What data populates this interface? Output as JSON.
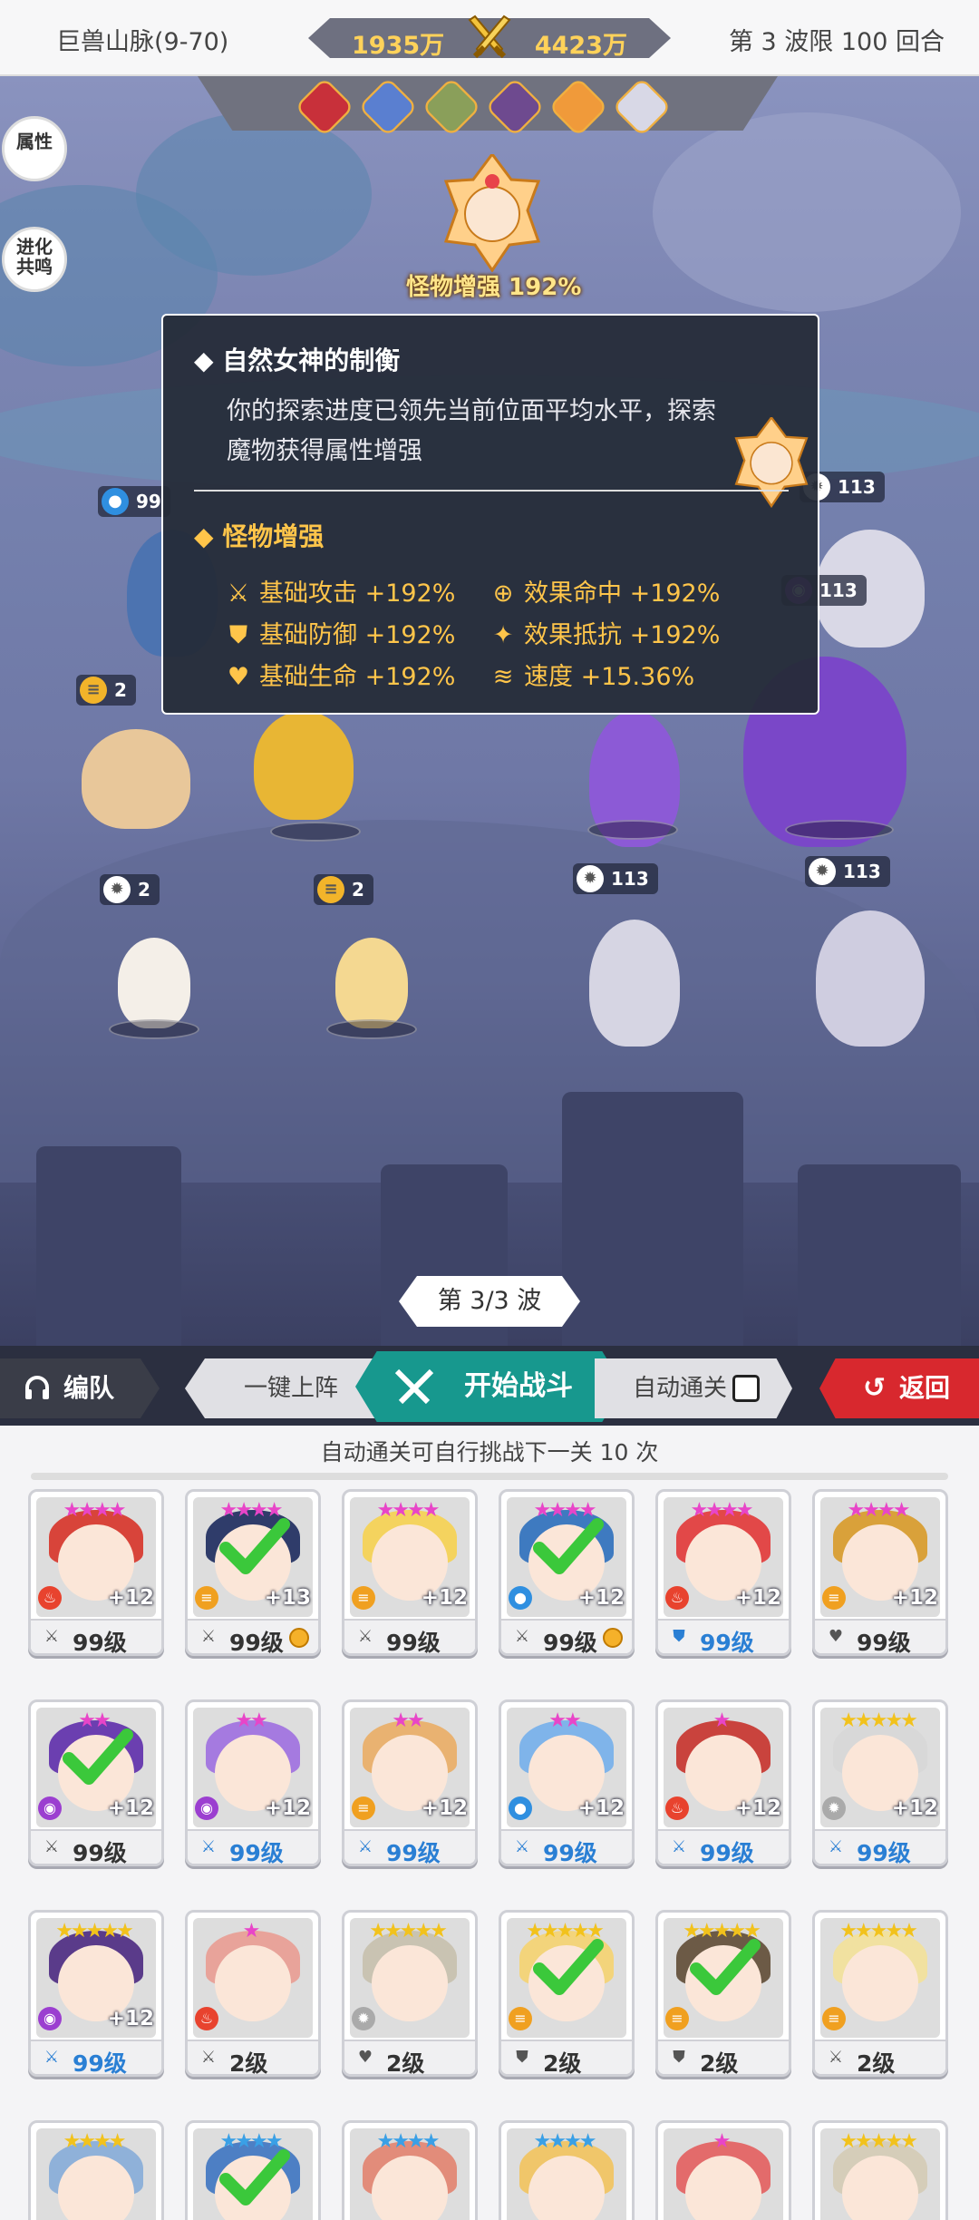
{
  "header": {
    "stage": "巨兽山脉(9-70)",
    "power_left": "1935万",
    "power_right": "4423万",
    "wave_limit": "第 3 波限 100 回合"
  },
  "side_buttons": {
    "attributes": "属性",
    "evolution": "进化\n共鸣"
  },
  "boss": {
    "label": "怪物增强 192%"
  },
  "units": {
    "ally_top_badge": "99",
    "ally_top_badge2": "99",
    "ally_left_badge": "2",
    "ally_front_badge1": "2",
    "ally_front_badge2": "2",
    "enemy_top_badge1": "113",
    "enemy_top_badge2": "113",
    "enemy_mid_badge": "113",
    "enemy_front_badge1": "113",
    "enemy_front_badge2": "113"
  },
  "tooltip": {
    "title": "◆ 自然女神的制衡",
    "desc": "你的探索进度已领先当前位面平均水平，探索魔物获得属性增强",
    "subtitle": "◆ 怪物增强",
    "stats": [
      {
        "icon": "attack-icon",
        "label": "基础攻击 +192%"
      },
      {
        "icon": "defense-icon",
        "label": "基础防御 +192%"
      },
      {
        "icon": "health-icon",
        "label": "基础生命 +192%"
      },
      {
        "icon": "accuracy-icon",
        "label": "效果命中 +192%"
      },
      {
        "icon": "resist-icon",
        "label": "效果抵抗 +192%"
      },
      {
        "icon": "speed-icon",
        "label": "速度 +15.36%"
      }
    ]
  },
  "wave": {
    "label": "第 3/3 波"
  },
  "actions": {
    "team": "编队",
    "deploy": "一键上阵",
    "start": "开始战斗",
    "auto": "自动通关",
    "back": "返回"
  },
  "roster": {
    "note": "自动通关可自行挑战下一关 10 次",
    "cards": [
      {
        "stars": "★★★★",
        "star_color": "#e845c8",
        "plus": "+12",
        "level": "99级",
        "elem": "fire",
        "elem_color": "#e8432e",
        "hair": "#d8443a",
        "lv_icon": "attack-icon",
        "blue": false,
        "check": false,
        "badge": false
      },
      {
        "stars": "★★★★",
        "star_color": "#e845c8",
        "plus": "+13",
        "level": "99级",
        "elem": "earth",
        "elem_color": "#f0a020",
        "hair": "#2f3c6a",
        "lv_icon": "attack-icon",
        "blue": false,
        "check": true,
        "badge": true
      },
      {
        "stars": "★★★★",
        "star_color": "#e845c8",
        "plus": "+12",
        "level": "99级",
        "elem": "earth",
        "elem_color": "#f0a020",
        "hair": "#f4d35e",
        "lv_icon": "attack-icon",
        "blue": false,
        "check": false,
        "badge": false
      },
      {
        "stars": "★★★★",
        "star_color": "#e845c8",
        "plus": "+12",
        "level": "99级",
        "elem": "water",
        "elem_color": "#2f8fe0",
        "hair": "#3e7ac0",
        "lv_icon": "attack-icon",
        "blue": false,
        "check": true,
        "badge": true
      },
      {
        "stars": "★★★★",
        "star_color": "#e845c8",
        "plus": "+12",
        "level": "99级",
        "elem": "fire",
        "elem_color": "#e8432e",
        "hair": "#e24848",
        "lv_icon": "defense-icon",
        "blue": true,
        "check": false,
        "badge": false
      },
      {
        "stars": "★★★★",
        "star_color": "#e845c8",
        "plus": "+12",
        "level": "99级",
        "elem": "earth",
        "elem_color": "#f0a020",
        "hair": "#d9a13a",
        "lv_icon": "health-icon",
        "blue": false,
        "check": false,
        "badge": false
      },
      {
        "stars": "★★",
        "star_color": "#e845c8",
        "plus": "+12",
        "level": "99级",
        "elem": "dark",
        "elem_color": "#9b3fd0",
        "hair": "#6b3fb0",
        "lv_icon": "attack-icon",
        "blue": false,
        "check": true,
        "badge": false
      },
      {
        "stars": "★★",
        "star_color": "#e845c8",
        "plus": "+12",
        "level": "99级",
        "elem": "dark",
        "elem_color": "#9b3fd0",
        "hair": "#a57ae0",
        "lv_icon": "attack-icon",
        "blue": true,
        "check": false,
        "badge": false
      },
      {
        "stars": "★★",
        "star_color": "#e845c8",
        "plus": "+12",
        "level": "99级",
        "elem": "earth",
        "elem_color": "#f0a020",
        "hair": "#e9b271",
        "lv_icon": "attack-icon",
        "blue": true,
        "check": false,
        "badge": false
      },
      {
        "stars": "★★",
        "star_color": "#e845c8",
        "plus": "+12",
        "level": "99级",
        "elem": "water",
        "elem_color": "#2f8fe0",
        "hair": "#7fb4ea",
        "lv_icon": "attack-icon",
        "blue": true,
        "check": false,
        "badge": false
      },
      {
        "stars": "★",
        "star_color": "#e845c8",
        "plus": "+12",
        "level": "99级",
        "elem": "fire",
        "elem_color": "#e8432e",
        "hair": "#c9433d",
        "lv_icon": "attack-icon",
        "blue": true,
        "check": false,
        "badge": false
      },
      {
        "stars": "★★★★★",
        "star_color": "#f2c21c",
        "plus": "+12",
        "level": "99级",
        "elem": "light",
        "elem_color": "#aaaaaa",
        "hair": "#d8d8d8",
        "lv_icon": "attack-icon",
        "blue": true,
        "check": false,
        "badge": false
      },
      {
        "stars": "★★★★★",
        "star_color": "#f2c21c",
        "plus": "+12",
        "level": "99级",
        "elem": "dark",
        "elem_color": "#9b3fd0",
        "hair": "#5a3b8a",
        "lv_icon": "attack-icon",
        "blue": true,
        "check": false,
        "badge": false
      },
      {
        "stars": "★",
        "star_color": "#e845c8",
        "plus": "",
        "level": "2级",
        "elem": "fire",
        "elem_color": "#e8432e",
        "hair": "#e8a39a",
        "lv_icon": "attack-icon",
        "blue": false,
        "check": false,
        "badge": false
      },
      {
        "stars": "★★★★★",
        "star_color": "#f2c21c",
        "plus": "",
        "level": "2级",
        "elem": "light",
        "elem_color": "#aaaaaa",
        "hair": "#c9c3b2",
        "lv_icon": "health-icon",
        "blue": false,
        "check": false,
        "badge": false
      },
      {
        "stars": "★★★★★",
        "star_color": "#f2c21c",
        "plus": "",
        "level": "2级",
        "elem": "earth",
        "elem_color": "#f0a020",
        "hair": "#f3d47b",
        "lv_icon": "defense-icon",
        "blue": false,
        "check": true,
        "badge": false
      },
      {
        "stars": "★★★★★",
        "star_color": "#f2c21c",
        "plus": "",
        "level": "2级",
        "elem": "earth",
        "elem_color": "#f0a020",
        "hair": "#6c5a46",
        "lv_icon": "defense-icon",
        "blue": false,
        "check": true,
        "badge": false
      },
      {
        "stars": "★★★★★",
        "star_color": "#f2c21c",
        "plus": "",
        "level": "2级",
        "elem": "earth",
        "elem_color": "#f0a020",
        "hair": "#f1e1a0",
        "lv_icon": "attack-icon",
        "blue": false,
        "check": false,
        "badge": false
      },
      {
        "stars": "★★★★",
        "star_color": "#f2c21c",
        "plus": "",
        "level": "",
        "elem": "",
        "elem_color": "#aaaaaa",
        "hair": "#8fb1d9",
        "lv_icon": "",
        "blue": false,
        "check": false,
        "badge": false
      },
      {
        "stars": "★★★★",
        "star_color": "#3aa0e6",
        "plus": "",
        "level": "",
        "elem": "",
        "elem_color": "#aaaaaa",
        "hair": "#4d7fc4",
        "lv_icon": "",
        "blue": false,
        "check": true,
        "badge": false
      },
      {
        "stars": "★★★★",
        "star_color": "#3aa0e6",
        "plus": "",
        "level": "",
        "elem": "",
        "elem_color": "#aaaaaa",
        "hair": "#e28c7a",
        "lv_icon": "",
        "blue": false,
        "check": false,
        "badge": false
      },
      {
        "stars": "★★★★",
        "star_color": "#3aa0e6",
        "plus": "",
        "level": "",
        "elem": "",
        "elem_color": "#aaaaaa",
        "hair": "#f0c66a",
        "lv_icon": "",
        "blue": false,
        "check": false,
        "badge": false
      },
      {
        "stars": "★",
        "star_color": "#e845c8",
        "plus": "",
        "level": "",
        "elem": "",
        "elem_color": "#aaaaaa",
        "hair": "#e36b6b",
        "lv_icon": "",
        "blue": false,
        "check": false,
        "badge": false
      },
      {
        "stars": "★★★★★",
        "star_color": "#f2c21c",
        "plus": "",
        "level": "",
        "elem": "",
        "elem_color": "#aaaaaa",
        "hair": "#d5cdb9",
        "lv_icon": "",
        "blue": false,
        "check": false,
        "badge": false
      }
    ]
  },
  "colors": {
    "accent_teal": "#17988e",
    "back_red": "#d8282e",
    "gold": "#ffc54a"
  }
}
